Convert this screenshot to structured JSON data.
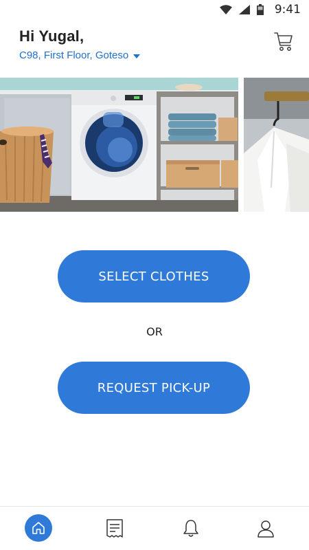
{
  "status_bar": {
    "time": "9:41",
    "icons": [
      "wifi-icon",
      "signal-icon",
      "battery-icon"
    ]
  },
  "header": {
    "greeting": "Hi Yugal,",
    "address": "C98, First Floor, Goteso",
    "cart_icon": "cart-icon"
  },
  "banner": {
    "slides": [
      "laundry-room-washing-machine",
      "white-shirts-on-hangers"
    ]
  },
  "actions": {
    "select_clothes": "SELECT CLOTHES",
    "separator": "OR",
    "request_pickup": "REQUEST PICK-UP"
  },
  "bottom_nav": {
    "items": [
      {
        "icon": "home-icon",
        "active": true
      },
      {
        "icon": "receipt-icon",
        "active": false
      },
      {
        "icon": "bell-icon",
        "active": false
      },
      {
        "icon": "user-icon",
        "active": false
      }
    ]
  },
  "colors": {
    "accent": "#2f7ad8",
    "address_link": "#1f6fd0",
    "text": "#222222",
    "background": "#ffffff"
  }
}
